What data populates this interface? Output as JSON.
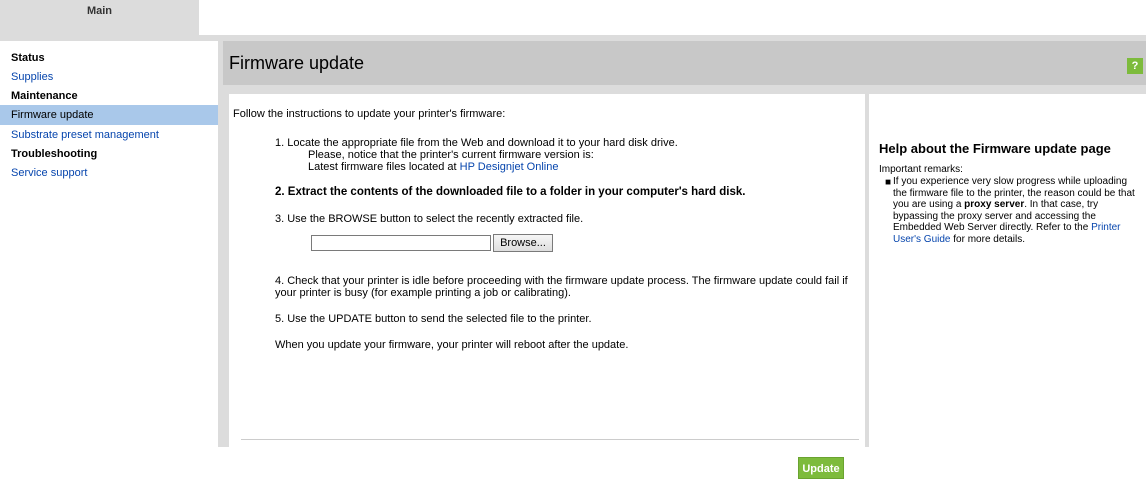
{
  "top": {
    "tab_label": "Main"
  },
  "sidebar": {
    "status_heading": "Status",
    "supplies": "Supplies",
    "maintenance_heading": "Maintenance",
    "firmware_update": "Firmware update",
    "substrate": "Substrate preset management",
    "troubleshooting_heading": "Troubleshooting",
    "service_support": "Service support"
  },
  "header": {
    "title": "Firmware update",
    "help_label": "?"
  },
  "main": {
    "intro": "Follow the instructions to update your printer's firmware:",
    "step1": "1. Locate the appropriate file from the Web and download it to your hard disk drive.",
    "step1_note": "Please, notice that the printer's current firmware version is:",
    "step1_latest_prefix": "Latest firmware files located at ",
    "step1_latest_link": "HP Designjet Online",
    "step2": "2. Extract the contents of the downloaded file to a folder in your computer's hard disk.",
    "step3": "3. Use the BROWSE button to select the recently extracted file.",
    "file_value": "",
    "browse_label": "Browse...",
    "step4_line1": "4. Check that your printer is idle before proceeding with the firmware update process. The firmware update could fail if",
    "step4_line2": "your printer is busy (for example printing a job or calibrating).",
    "step5": "5. Use the UPDATE button to send the selected file to the printer.",
    "reboot_note": "When you update your firmware, your printer will reboot after the update.",
    "update_label": "Update"
  },
  "help": {
    "title": "Help about the Firmware update page",
    "remarks": "Important remarks:",
    "text_part1": "If you experience very slow progress while uploading the firmware file to the printer, the reason could be that you are using a ",
    "text_bold": "proxy server",
    "text_part2": ". In that case, try bypassing the proxy server and accessing the Embedded Web Server directly. Refer to the ",
    "text_link": "Printer User's Guide",
    "text_part3": " for more details."
  },
  "colors": {
    "accent_green": "#7dbb3c",
    "active_nav": "#a9c8ea",
    "link": "#0645ad"
  }
}
